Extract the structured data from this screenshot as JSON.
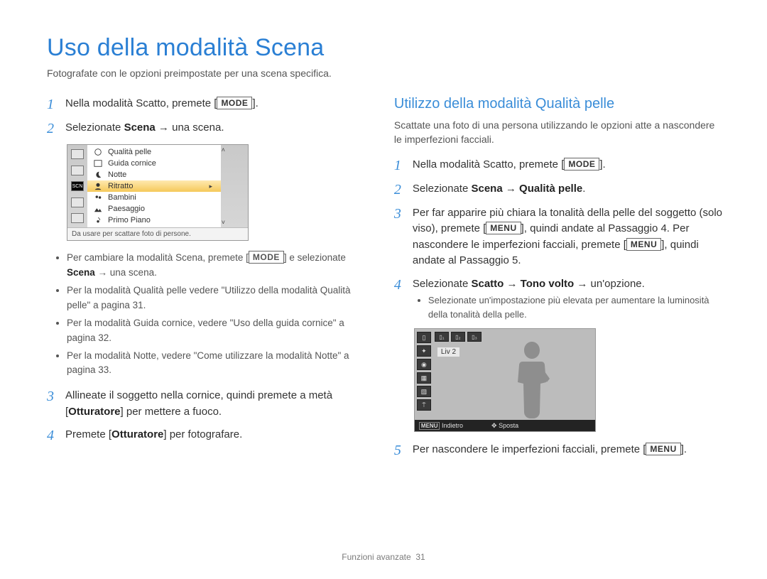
{
  "page": {
    "title": "Uso della modalità Scena",
    "subtitle": "Fotografate con le opzioni preimpostate per una scena specifica.",
    "footer_section": "Funzioni avanzate",
    "footer_page": "31"
  },
  "buttons": {
    "mode": "MODE",
    "menu": "MENU"
  },
  "left": {
    "step1_pre": "Nella modalità Scatto, premete [",
    "step1_post": "].",
    "step2_pre": "Selezionate ",
    "step2_bold": "Scena",
    "step2_post": " → una scena.",
    "scene_items": {
      "i0": "Qualità pelle",
      "i1": "Guida cornice",
      "i2": "Notte",
      "i3": "Ritratto",
      "i4": "Bambini",
      "i5": "Paesaggio",
      "i6": "Primo Piano"
    },
    "scene_hint": "Da usare per scattare foto di persone.",
    "scn_badge": "SCN",
    "bullets": {
      "b0_pre": "Per cambiare la modalità Scena, premete [",
      "b0_mid": "] e selezionate ",
      "b0_bold": "Scena",
      "b0_post": " → una scena.",
      "b1": "Per la modalità Qualità pelle vedere \"Utilizzo della modalità Qualità pelle\" a pagina 31.",
      "b2": "Per la modalità Guida cornice, vedere \"Uso della guida cornice\" a pagina 32.",
      "b3": "Per la modalità Notte, vedere \"Come utilizzare la modalità Notte\" a pagina 33."
    },
    "step3_pre": "Allineate il soggetto nella cornice, quindi premete a metà [",
    "step3_bold": "Otturatore",
    "step3_post": "] per mettere a fuoco.",
    "step4_pre": "Premete [",
    "step4_bold": "Otturatore",
    "step4_post": "] per fotografare."
  },
  "right": {
    "heading": "Utilizzo della modalità Qualità pelle",
    "desc": "Scattate una foto di una persona utilizzando le opzioni atte a nascondere le imperfezioni facciali.",
    "step1_pre": "Nella modalità Scatto, premete [",
    "step1_post": "].",
    "step2_pre": "Selezionate ",
    "step2_b1": "Scena",
    "step2_mid": " → ",
    "step2_b2": "Qualità pelle",
    "step2_post": ".",
    "step3_a": "Per far apparire più chiara la tonalità della pelle del soggetto (solo viso), premete [",
    "step3_b": "], quindi andate al Passaggio 4. Per nascondere le imperfezioni facciali, premete [",
    "step3_c": "], quindi andate al Passaggio 5.",
    "step4_pre": "Selezionate ",
    "step4_b1": "Scatto",
    "step4_mid1": " → ",
    "step4_b2": "Tono volto",
    "step4_mid2": " → un'opzione.",
    "step4_sub": "Selezionate un'impostazione più elevata per aumentare la luminosità della tonalità della pelle.",
    "liv_label": "Liv 2",
    "liv_footer_back": "Indietro",
    "liv_footer_move": "Sposta",
    "step5_pre": "Per nascondere le imperfezioni facciali, premete [",
    "step5_post": "]."
  }
}
